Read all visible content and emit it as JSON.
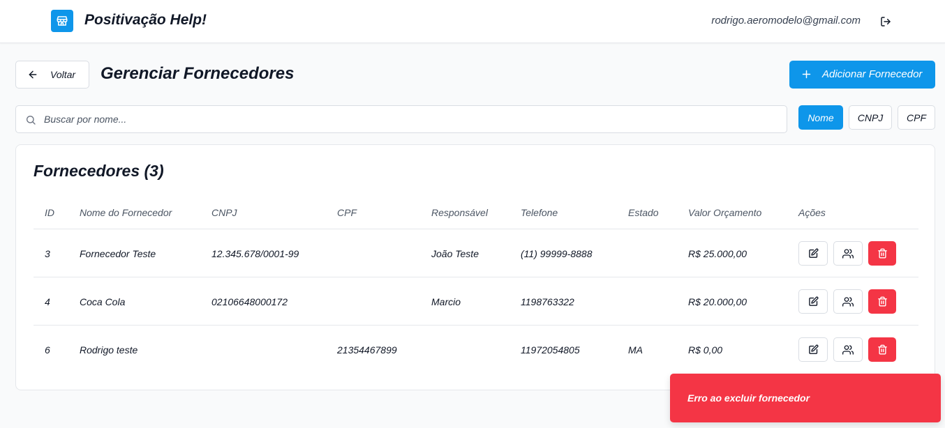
{
  "header": {
    "app_title": "Positivação Help!",
    "user_email": "rodrigo.aeromodelo@gmail.com",
    "logo_icon": "store-icon",
    "logout_icon": "logout-icon"
  },
  "toolbar": {
    "back_label": "Voltar",
    "page_title": "Gerenciar Fornecedores",
    "add_label": "Adicionar Fornecedor"
  },
  "search": {
    "placeholder": "Buscar por nome...",
    "value": "",
    "filters": [
      {
        "label": "Nome",
        "active": true
      },
      {
        "label": "CNPJ",
        "active": false
      },
      {
        "label": "CPF",
        "active": false
      }
    ]
  },
  "table": {
    "title": "Fornecedores (3)",
    "columns": [
      "ID",
      "Nome do Fornecedor",
      "CNPJ",
      "CPF",
      "Responsável",
      "Telefone",
      "Estado",
      "Valor Orçamento",
      "Ações"
    ],
    "rows": [
      {
        "id": "3",
        "nome": "Fornecedor Teste",
        "cnpj": "12.345.678/0001-99",
        "cpf": "",
        "responsavel": "João Teste",
        "telefone": "(11) 99999-8888",
        "estado": "",
        "valor": "R$ 25.000,00"
      },
      {
        "id": "4",
        "nome": "Coca Cola",
        "cnpj": "02106648000172",
        "cpf": "",
        "responsavel": "Marcio",
        "telefone": "1198763322",
        "estado": "",
        "valor": "R$ 20.000,00"
      },
      {
        "id": "6",
        "nome": "Rodrigo teste",
        "cnpj": "",
        "cpf": "21354467899",
        "responsavel": "",
        "telefone": "11972054805",
        "estado": "MA",
        "valor": "R$ 0,00"
      }
    ],
    "row_actions": [
      "edit-icon",
      "users-icon",
      "trash-icon"
    ]
  },
  "toast": {
    "message": "Erro ao excluir fornecedor"
  },
  "colors": {
    "primary": "#0e96ea",
    "danger": "#f43545",
    "border": "#d9dde3"
  }
}
